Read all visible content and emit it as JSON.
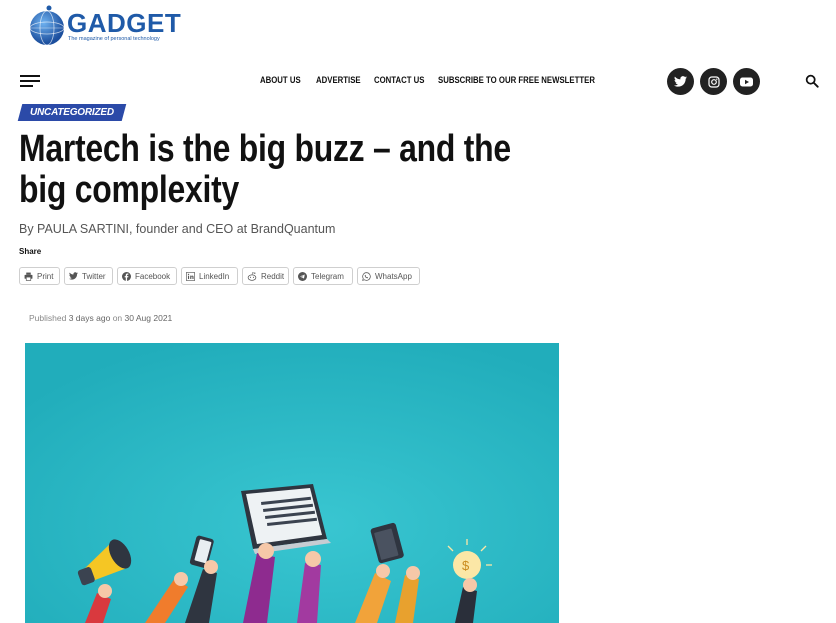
{
  "logo": {
    "name": "GADGET",
    "tagline": "The magazine of personal technology"
  },
  "nav": {
    "items": [
      "ABOUT US",
      "ADVERTISE",
      "CONTACT US",
      "SUBSCRIBE TO OUR FREE NEWSLETTER"
    ]
  },
  "social": [
    "twitter-icon",
    "instagram-icon",
    "youtube-icon"
  ],
  "article": {
    "category": "UNCATEGORIZED",
    "title": "Martech is the big buzz – and the big complexity",
    "byline": "By PAULA SARTINI, founder and CEO at BrandQuantum",
    "share_label": "Share",
    "share_buttons": [
      "Print",
      "Twitter",
      "Facebook",
      "LinkedIn",
      "Reddit",
      "Telegram",
      "WhatsApp"
    ],
    "published_prefix": "Published",
    "published_ago": "3 days ago",
    "published_on": "on",
    "published_date": "30 Aug 2021"
  },
  "colors": {
    "category_bg": "#2b4aa8",
    "hero_bg": "#27b5c2",
    "logo_blue": "#1f5aa8"
  }
}
